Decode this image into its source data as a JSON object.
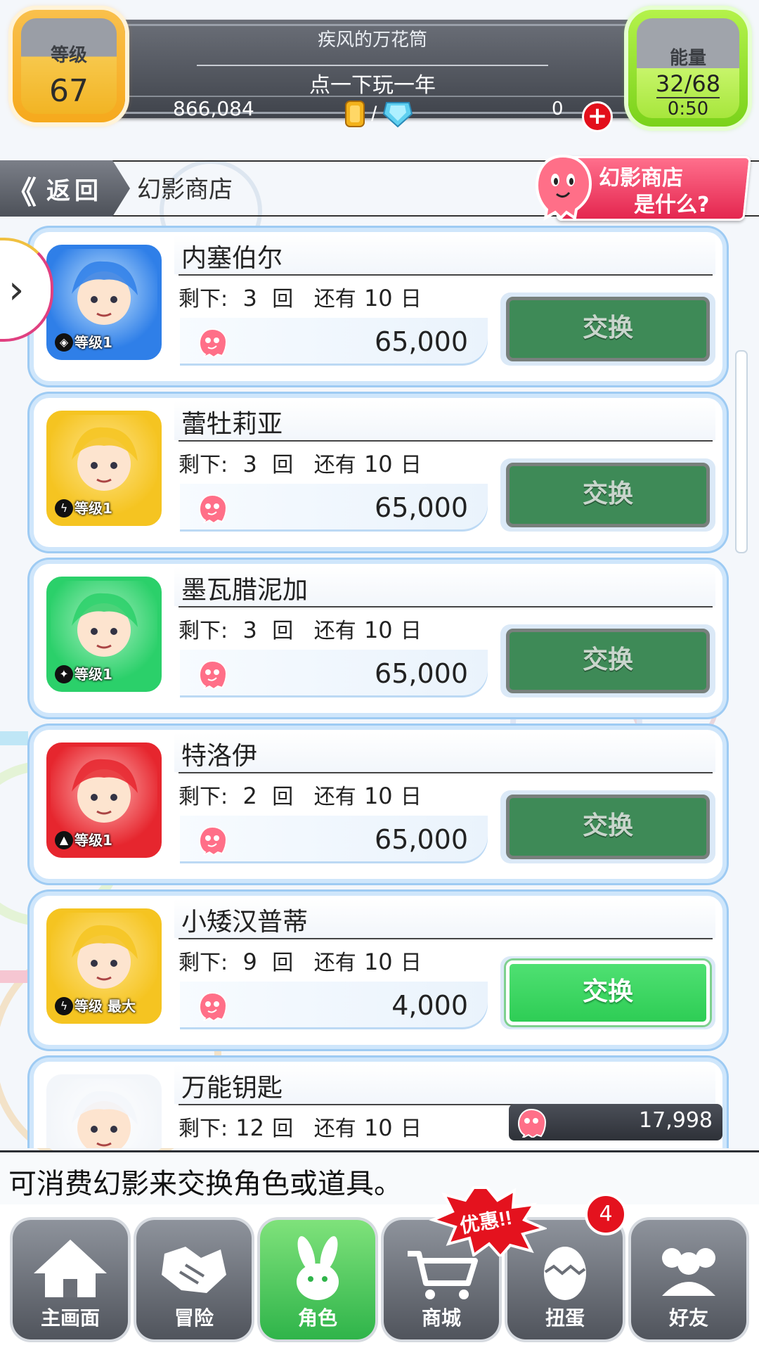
{
  "hud": {
    "level_label": "等级",
    "level_value": "67",
    "player_name": "疾风的万花筒",
    "player_title": "点一下玩一年",
    "gold": "866,084",
    "currency_separator": "/",
    "stone_count": "0",
    "plus_symbol": "+",
    "energy_label": "能量",
    "energy_value": "32/68",
    "energy_timer": "0:50"
  },
  "titlebar": {
    "back_arrows": "《",
    "back_label": "返回",
    "page_title": "幻影商店",
    "help_line1": "幻影商店",
    "help_line2": "是什么?"
  },
  "side_arrow": "›",
  "items": [
    {
      "name": "内塞伯尔",
      "remain_label": "剩下:",
      "remain": "3",
      "times_label": "回",
      "days_label": "还有",
      "days": "10",
      "day_unit": "日",
      "price": "65,000",
      "button": "交换",
      "level": "等级1",
      "element": "water",
      "active": false
    },
    {
      "name": "蕾牡莉亚",
      "remain_label": "剩下:",
      "remain": "3",
      "times_label": "回",
      "days_label": "还有",
      "days": "10",
      "day_unit": "日",
      "price": "65,000",
      "button": "交换",
      "level": "等级1",
      "element": "light",
      "active": false
    },
    {
      "name": "墨瓦腊泥加",
      "remain_label": "剩下:",
      "remain": "3",
      "times_label": "回",
      "days_label": "还有",
      "days": "10",
      "day_unit": "日",
      "price": "65,000",
      "button": "交换",
      "level": "等级1",
      "element": "wood",
      "active": false
    },
    {
      "name": "特洛伊",
      "remain_label": "剩下:",
      "remain": "2",
      "times_label": "回",
      "days_label": "还有",
      "days": "10",
      "day_unit": "日",
      "price": "65,000",
      "button": "交换",
      "level": "等级1",
      "element": "fire",
      "active": false
    },
    {
      "name": "小矮汉普蒂",
      "remain_label": "剩下:",
      "remain": "9",
      "times_label": "回",
      "days_label": "还有",
      "days": "10",
      "day_unit": "日",
      "price": "4,000",
      "button": "交换",
      "level": "等级 最大",
      "element": "light",
      "active": true
    },
    {
      "name": "万能钥匙",
      "remain_label": "剩下:",
      "remain": "12",
      "times_label": "回",
      "days_label": "还有",
      "days": "10",
      "day_unit": "日",
      "price": "",
      "button": "",
      "level": "",
      "element": "",
      "active": true
    }
  ],
  "balance": "17,998",
  "description": "可消费幻影来交换角色或道具。",
  "tabs": [
    {
      "label": "主画面",
      "icon": "home-icon"
    },
    {
      "label": "冒险",
      "icon": "handshake-icon"
    },
    {
      "label": "角色",
      "icon": "rabbit-icon"
    },
    {
      "label": "商城",
      "icon": "cart-icon"
    },
    {
      "label": "扭蛋",
      "icon": "egg-icon"
    },
    {
      "label": "好友",
      "icon": "friends-icon"
    }
  ],
  "promo_label": "优惠!!",
  "gacha_badge": "4",
  "colors": {
    "accent_green": "#2ecd55",
    "disabled_green": "#3e8a57",
    "level_orange": "#f6a91c",
    "energy_green": "#7ad21a",
    "help_pink": "#e4264f"
  }
}
